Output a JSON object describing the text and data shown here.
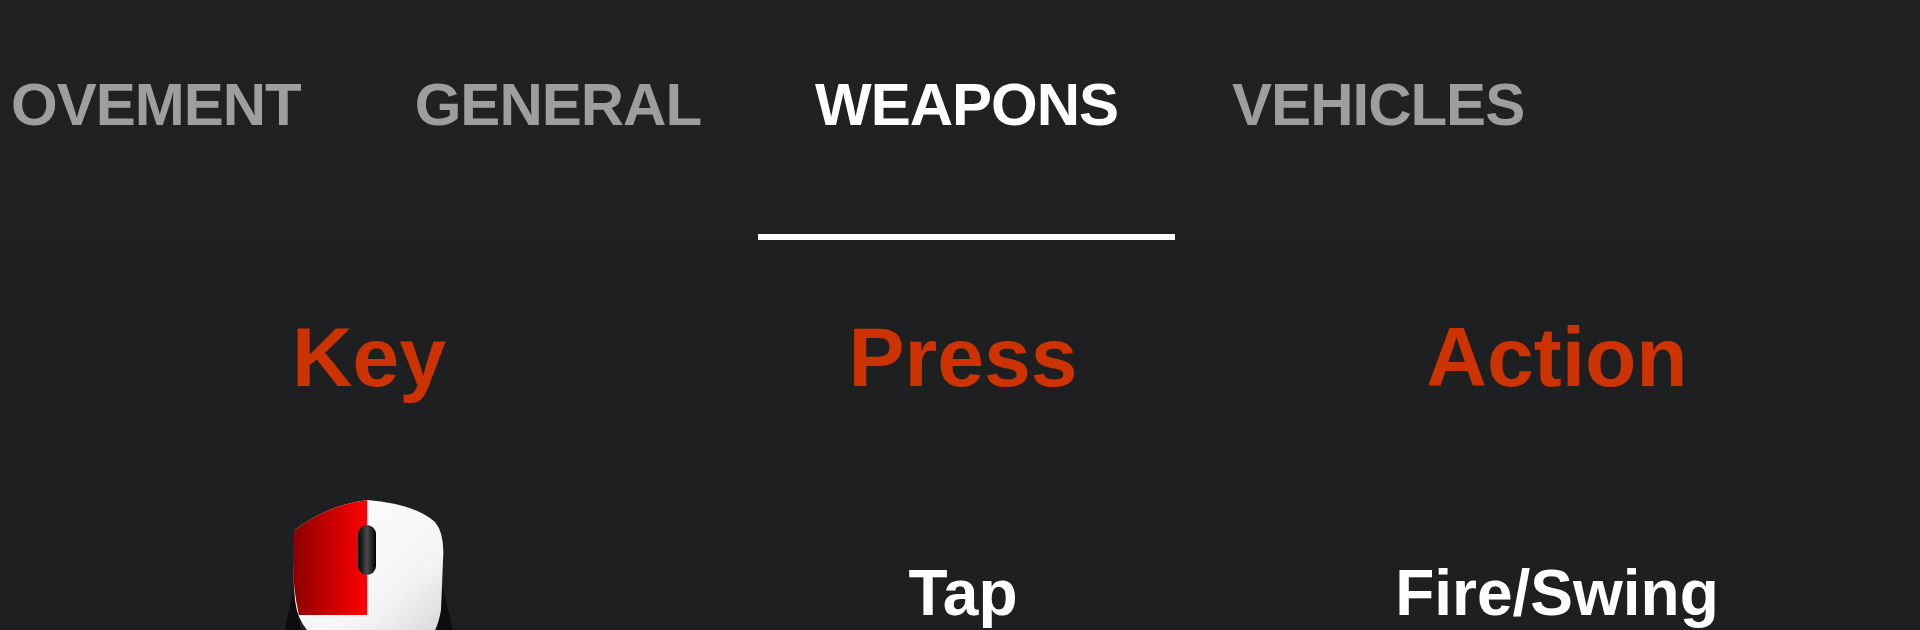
{
  "tabs": [
    {
      "label": "OVEMENT",
      "selected": false
    },
    {
      "label": "GENERAL",
      "selected": false
    },
    {
      "label": "WEAPONS",
      "selected": true
    },
    {
      "label": "VEHICLES",
      "selected": false
    }
  ],
  "table": {
    "columns": [
      "Key",
      "Press",
      "Action"
    ],
    "rows": [
      {
        "press": "Tap",
        "action": "Fire/Swing"
      }
    ]
  }
}
